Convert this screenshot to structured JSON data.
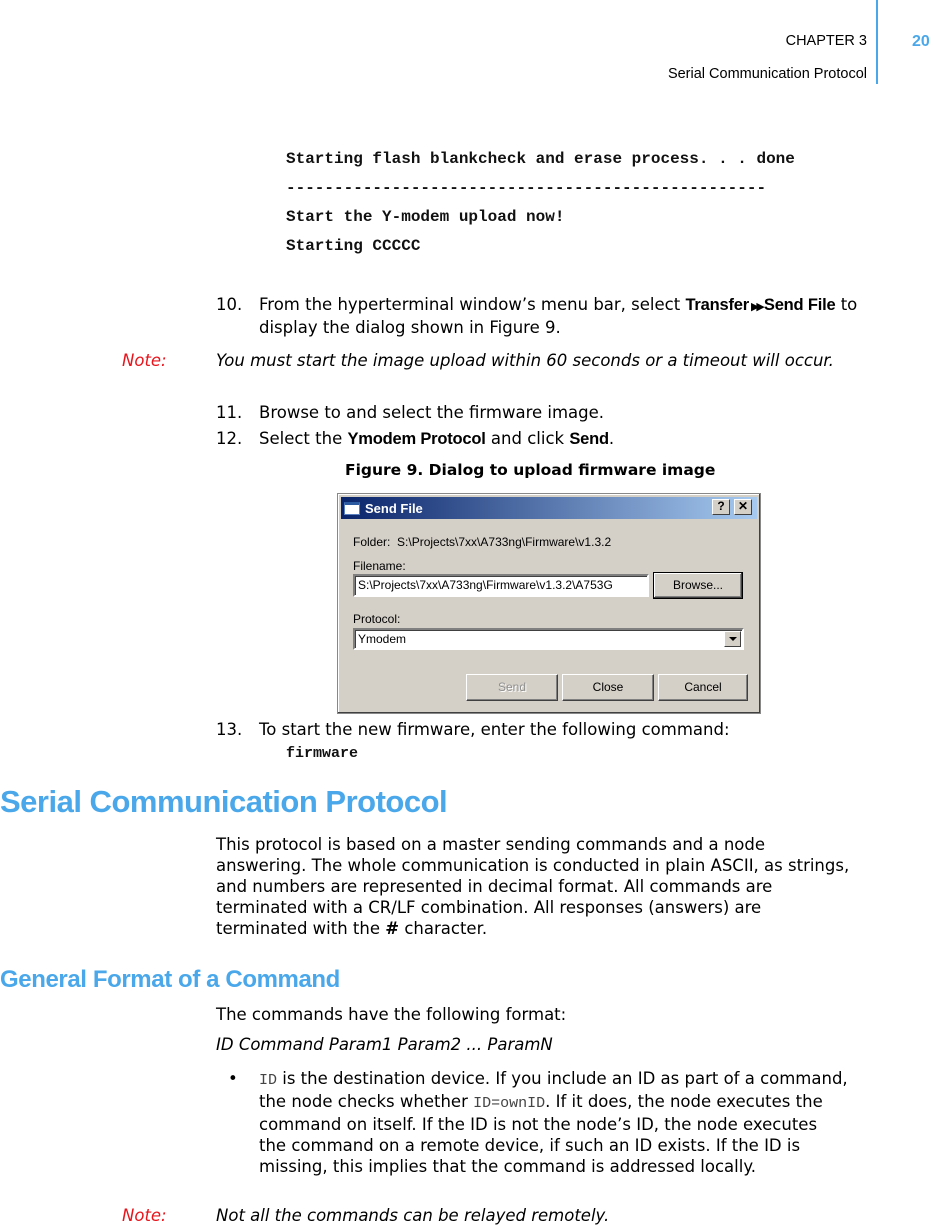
{
  "header": {
    "chapter": "CHAPTER 3",
    "section": "Serial Communication Protocol",
    "page_number": "20"
  },
  "console_output": {
    "lines": [
      "Starting flash blankcheck and erase process. . . done",
      "--------------------------------------------------",
      "Start the Y-modem upload now!",
      "Starting CCCCC"
    ]
  },
  "steps": {
    "s10": {
      "number": "10.",
      "text_before": "From the hyperterminal window’s menu bar, select ",
      "menu_path_1": "Transfer",
      "menu_separator_icon": "double-right-arrow",
      "menu_separator_glyph": "⏩",
      "menu_path_2": "Send File",
      "text_after": " to display the dialog shown in Figure 9."
    },
    "s11": {
      "number": "11.",
      "text": "Browse to and select the firmware image."
    },
    "s12": {
      "number": "12.",
      "text_before": "Select the ",
      "ui_1": "Ymodem Protocol",
      "text_mid": " and click ",
      "ui_2": "Send",
      "text_after": "."
    },
    "s13": {
      "number": "13.",
      "text": "To start the new firmware, enter the following command:",
      "command": "firmware"
    }
  },
  "note1": {
    "label": "Note:",
    "text": "You must start the image upload within 60 seconds or a timeout will occur."
  },
  "figure": {
    "caption": "Figure 9.  Dialog to upload firmware image"
  },
  "dialog": {
    "title": "Send File",
    "help_button": "?",
    "close_button": "✕",
    "folder_label": "Folder:",
    "folder_value": "S:\\Projects\\7xx\\A733ng\\Firmware\\v1.3.2",
    "filename_label": "Filename:",
    "filename_value": "S:\\Projects\\7xx\\A733ng\\Firmware\\v1.3.2\\A753G",
    "browse_button": "Browse...",
    "protocol_label": "Protocol:",
    "protocol_value": "Ymodem",
    "send_button": "Send",
    "close_btn_label": "Close",
    "cancel_button": "Cancel"
  },
  "section_serial": {
    "heading": "Serial Communication Protocol",
    "paragraph_before": "This protocol is based on a master sending commands and a node answering. The whole communication is conducted in plain ASCII, as strings, and numbers are represented in decimal format. All commands are terminated with a CR/LF combination. All responses (answers) are terminated with the ",
    "paragraph_symbol": "#",
    "paragraph_after": " character."
  },
  "section_format": {
    "heading": "General Format of a Command",
    "intro": "The commands have the following format:",
    "format": "ID Command Param1 Param2 ... ParamN",
    "bullet": {
      "symbol": "•",
      "code_1": "ID",
      "text_1": " is the destination device. If you include an ID as part of a command, the node checks whether ",
      "code_2": "ID=ownID",
      "text_2": ". If it does, the node executes the command on itself. If the ID is not the node’s ID, the node executes the command on a remote device, if such an ID exists. If the ID is missing, this implies that the command is addressed locally."
    }
  },
  "note2": {
    "label": "Note:",
    "text": "Not all the commands can be relayed remotely."
  },
  "colors": {
    "accent_blue": "#4aa8ea",
    "note_red": "#e8141c",
    "dialog_face": "#d4d0c8",
    "title_bar_start": "#0a246a",
    "title_bar_end": "#a6caf0"
  }
}
